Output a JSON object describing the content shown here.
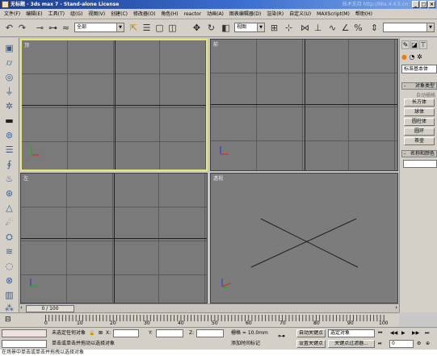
{
  "window": {
    "title": "无标题 - 3ds max 7 - Stand-alone License",
    "watermark": "技术支持 http://bbs.4.4.5.cn"
  },
  "menu": [
    "文件(F)",
    "编辑(E)",
    "工具(T)",
    "组(G)",
    "视图(V)",
    "创建(C)",
    "修改器(O)",
    "角色(H)",
    "reactor",
    "动画(A)",
    "图表编辑器(D)",
    "渲染(R)",
    "自定义(U)",
    "MAXScript(M)",
    "帮助(H)"
  ],
  "toolbar": {
    "filter_select": "全部",
    "coord_select": "视图",
    "selection_set": ""
  },
  "viewports": [
    {
      "label": "顶",
      "active": true
    },
    {
      "label": "前",
      "active": false
    },
    {
      "label": "左",
      "active": false
    },
    {
      "label": "透视",
      "active": false
    }
  ],
  "command_panel": {
    "category_dropdown": "标准基本体",
    "object_type_header": "对象类型",
    "auto_grid": "自动栅格",
    "buttons": [
      "长方体",
      "球体",
      "圆柱体",
      "圆环",
      "茶壶"
    ],
    "name_color_header": "名称和颜色"
  },
  "timeline": {
    "frame_display": "0 / 100",
    "ruler_labels": [
      "0",
      "10",
      "20",
      "30",
      "40",
      "50",
      "60",
      "70",
      "80",
      "90",
      "100"
    ]
  },
  "status": {
    "selection_info": "未选定任何对象",
    "prompt": "单击或单击并拖动以选择对象",
    "x_label": "X:",
    "y_label": "Y:",
    "z_label": "Z:",
    "grid_label": "栅格 = 10.0mm",
    "add_time_tag": "添加时间标记",
    "auto_key": "自动关键点",
    "set_key": "设置关键点",
    "key_filter": "关键点过滤器...",
    "selected_dropdown": "选定对象",
    "frame_value": "0"
  },
  "caption": "在场景中单击或单击并拖拽以选择对象"
}
